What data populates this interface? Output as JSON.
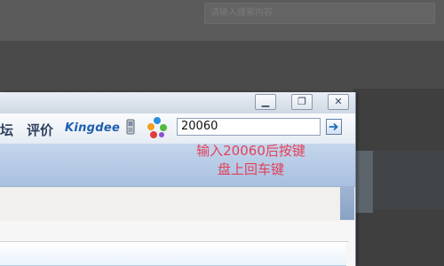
{
  "background": {
    "search_placeholder": "请输入搜索内容"
  },
  "window_controls": {
    "minimize_glyph": "▁",
    "restore_glyph": "❐",
    "close_glyph": "✕"
  },
  "toolbar": {
    "forum_label": "坛",
    "review_label": "评价",
    "brand": "Kingdee",
    "phone_icon": "phone-icon",
    "logo_icon": "pinwheel-logo-icon",
    "input_value": "20060",
    "go_icon": "arrow-right-icon"
  },
  "hint": {
    "line1": "输入20060后按键",
    "line2": "盘上回车键"
  },
  "colors": {
    "hint_red": "#e2405a",
    "brand_blue": "#1e5fb0"
  }
}
